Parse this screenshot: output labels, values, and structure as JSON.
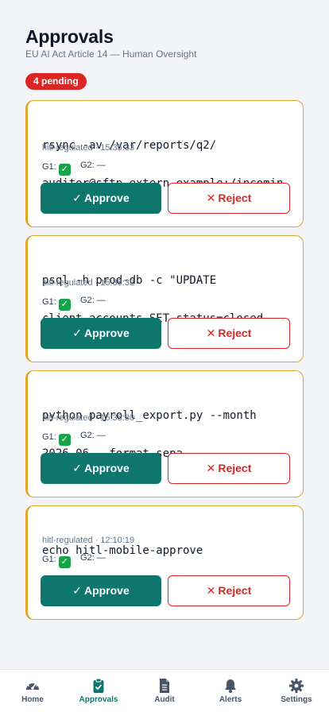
{
  "header": {
    "title": "Approvals",
    "subtitle": "EU AI Act Article 14 — Human Oversight",
    "pending_badge": "4 pending"
  },
  "approvals": [
    {
      "command_lines": [
        "rsync -av /var/reports/q2/",
        "auditor@sftp.extern.example:/incomin…"
      ],
      "policy": "hitl-regulated",
      "time": "15:35:33",
      "g1_label": "G1:",
      "g2_label": "G2:",
      "g2_value": "—",
      "approve_label": "Approve",
      "reject_label": "Reject"
    },
    {
      "command_lines": [
        "psql -h prod-db -c \"UPDATE",
        "client_accounts SET status=closed …"
      ],
      "policy": "hitl-regulated",
      "time": "15:35:32",
      "g1_label": "G1:",
      "g2_label": "G2:",
      "g2_value": "—",
      "approve_label": "Approve",
      "reject_label": "Reject"
    },
    {
      "command_lines": [
        "python payroll_export.py --month",
        "2026-06 --format sepa"
      ],
      "policy": "hitl-regulated",
      "time": "15:35:30",
      "g1_label": "G1:",
      "g2_label": "G2:",
      "g2_value": "—",
      "approve_label": "Approve",
      "reject_label": "Reject"
    },
    {
      "command_lines": [
        "echo hitl-mobile-approve"
      ],
      "policy": "hitl-regulated",
      "time": "12:10:19",
      "g1_label": "G1:",
      "g2_label": "G2:",
      "g2_value": "—",
      "approve_label": "Approve",
      "reject_label": "Reject"
    }
  ],
  "tabbar": {
    "items": [
      {
        "label": "Home",
        "icon": "gauge-icon"
      },
      {
        "label": "Approvals",
        "icon": "clipboard-check-icon",
        "active": true
      },
      {
        "label": "Audit",
        "icon": "document-icon"
      },
      {
        "label": "Alerts",
        "icon": "bell-icon"
      },
      {
        "label": "Settings",
        "icon": "gear-icon"
      }
    ]
  },
  "colors": {
    "accent": "#0f766e",
    "danger": "#dc2626",
    "pending_border": "#e0a62a",
    "check_green": "#16a34a"
  }
}
